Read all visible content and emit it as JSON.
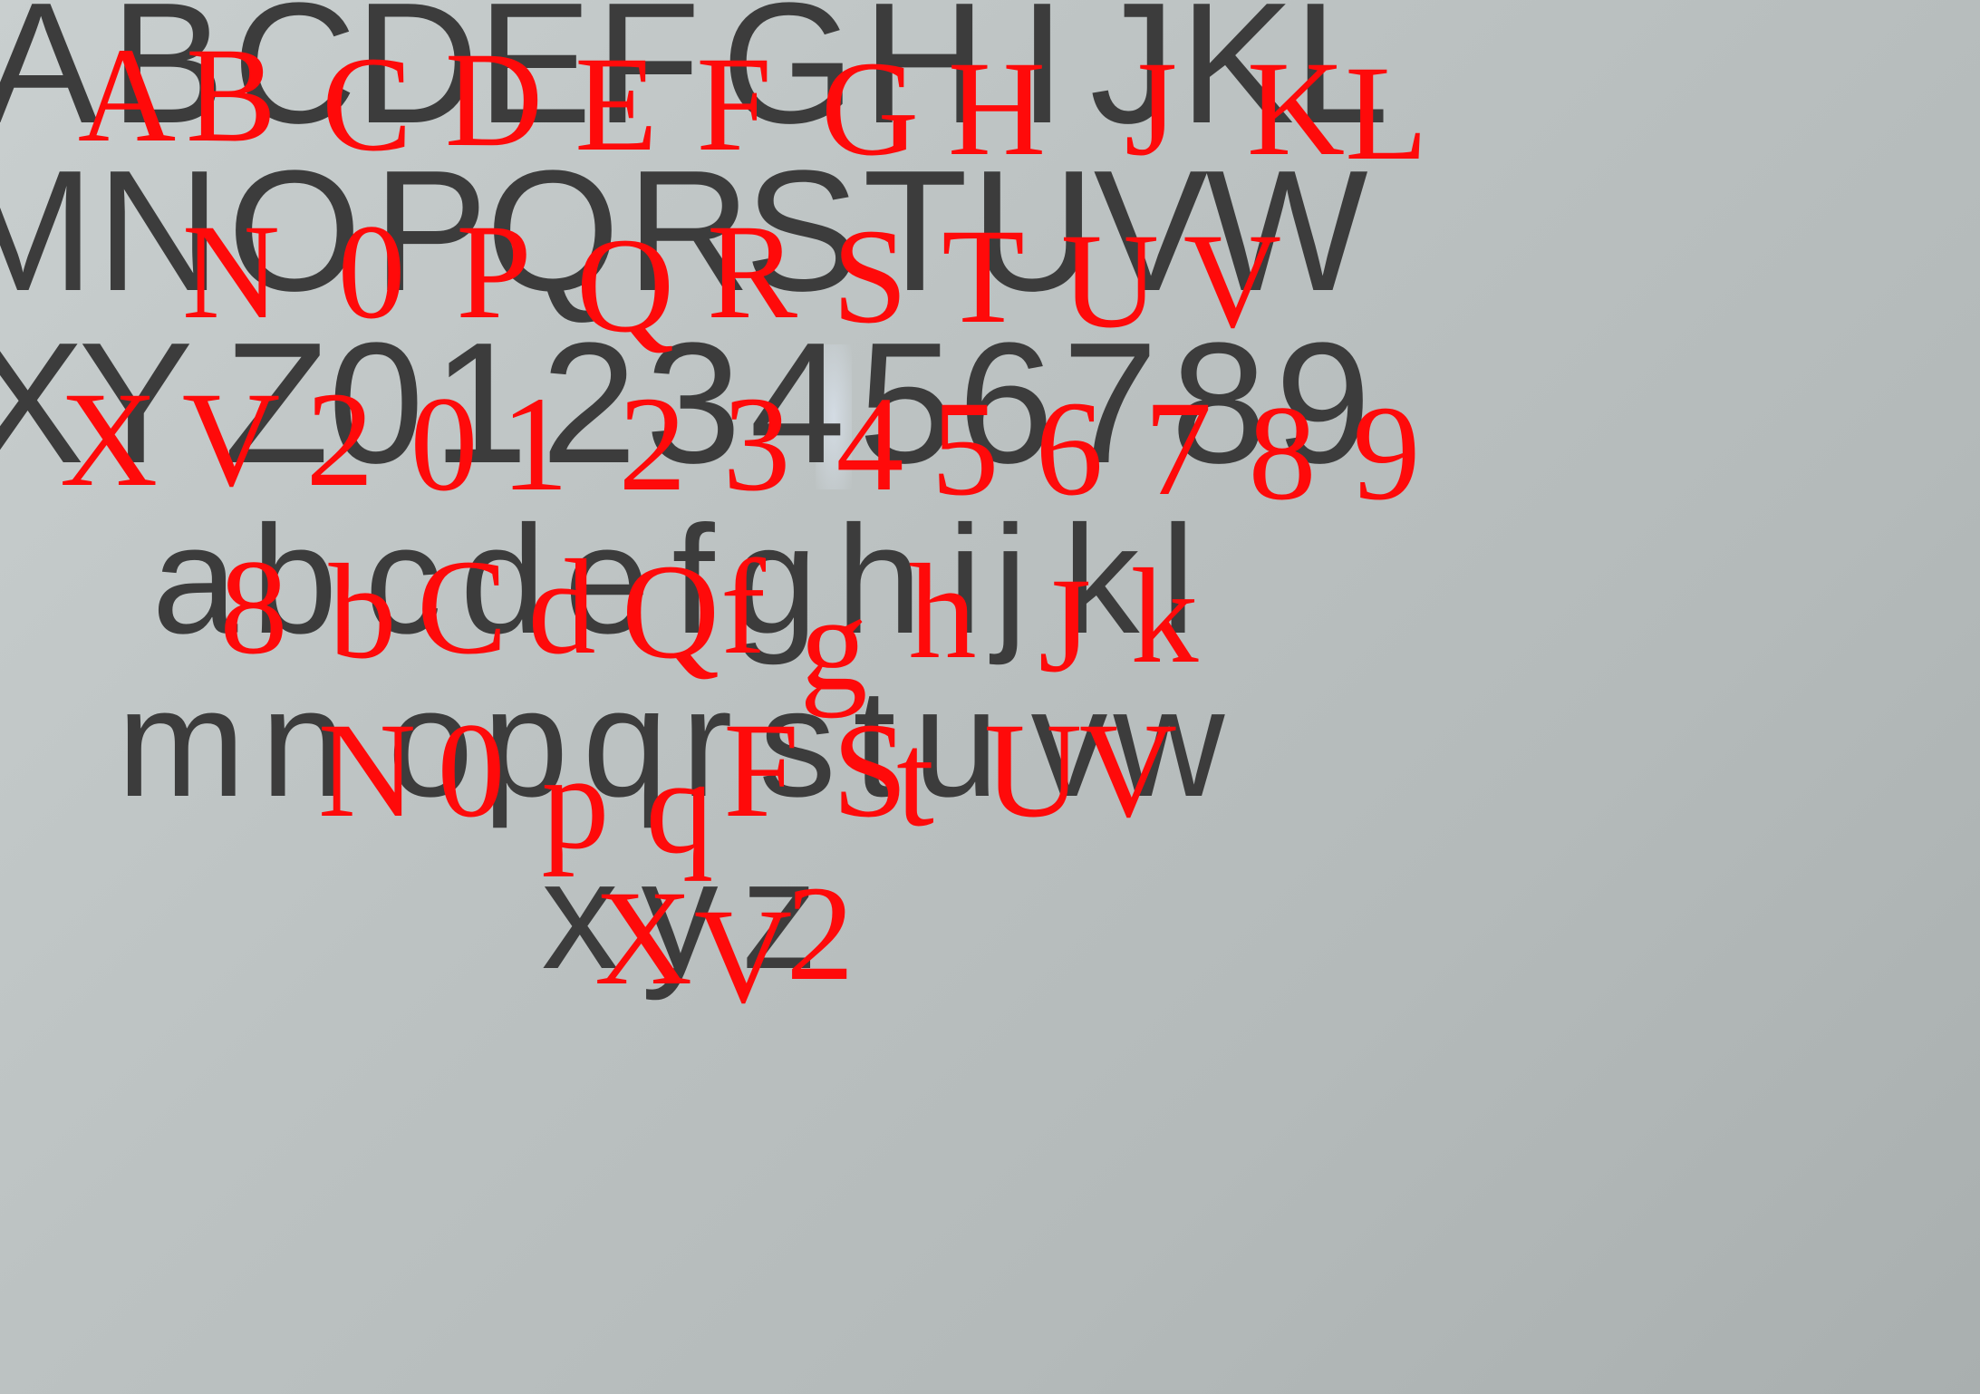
{
  "printed_rows": [
    [
      "A",
      "B",
      "C",
      "D",
      "E",
      "F",
      "G",
      "H",
      "I",
      "J",
      "K",
      "L"
    ],
    [
      "M",
      "N",
      "O",
      "P",
      "Q",
      "R",
      "S",
      "T",
      "U",
      "V",
      "W"
    ],
    [
      "X",
      "Y",
      "Z",
      "0",
      "1",
      "2",
      "3",
      "4",
      "5",
      "6",
      "7",
      "8",
      "9"
    ],
    [
      "a",
      "b",
      "c",
      "d",
      "e",
      "f",
      "g",
      "h",
      "i",
      "j",
      "k",
      "l"
    ],
    [
      "m",
      "n",
      "o",
      "p",
      "q",
      "r",
      "s",
      "t",
      "u",
      "v",
      "w"
    ],
    [
      "x",
      "y",
      "z"
    ]
  ],
  "recognized_labels": [
    "A",
    "B",
    "C",
    "D",
    "E",
    "F",
    "G",
    "H",
    "J",
    "K",
    "L",
    "N",
    "0",
    "P",
    "Q",
    "R",
    "S",
    "T",
    "U",
    "V",
    "X",
    "V",
    "2",
    "0",
    "1",
    "2",
    "3",
    "4",
    "5",
    "6",
    "7",
    "8",
    "9",
    "8",
    "b",
    "C",
    "d",
    "Q",
    "f",
    "g",
    "h",
    "J",
    "k",
    "N",
    "0",
    "p",
    "q",
    "F",
    "S",
    "t",
    "U",
    "V",
    "X",
    "V",
    "2"
  ],
  "colors": {
    "printed_text": "#3c3c3c",
    "recognized_text": "#ff0a0a",
    "background": "#bcc2c2"
  }
}
